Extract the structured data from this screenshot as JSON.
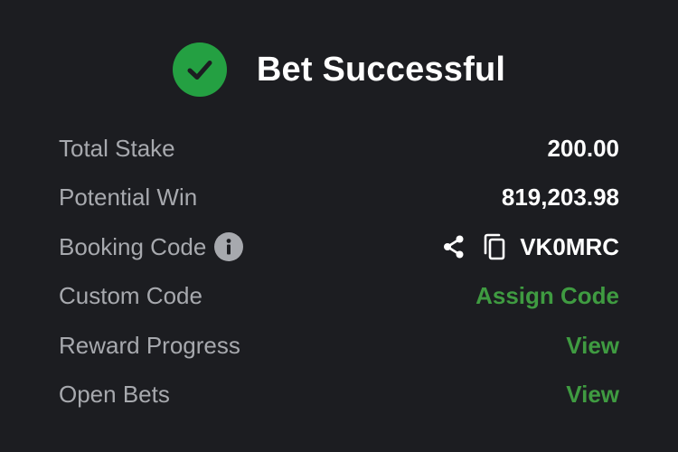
{
  "header": {
    "title": "Bet Successful",
    "icon": "check-circle-icon",
    "accent_color": "#24a042"
  },
  "rows": [
    {
      "label": "Total Stake",
      "value": "200.00"
    },
    {
      "label": "Potential Win",
      "value": "819,203.98"
    },
    {
      "label": "Booking Code",
      "label_icon": "info-icon",
      "value": "VK0MRC",
      "actions": [
        "share-icon",
        "copy-icon"
      ]
    },
    {
      "label": "Custom Code",
      "value": "Assign Code"
    },
    {
      "label": "Reward Progress",
      "value": "View"
    },
    {
      "label": "Open Bets",
      "value": "View"
    }
  ],
  "colors": {
    "background": "#1c1d21",
    "label": "#a7a9ae",
    "value": "#ffffff",
    "link": "#3f9b41"
  }
}
